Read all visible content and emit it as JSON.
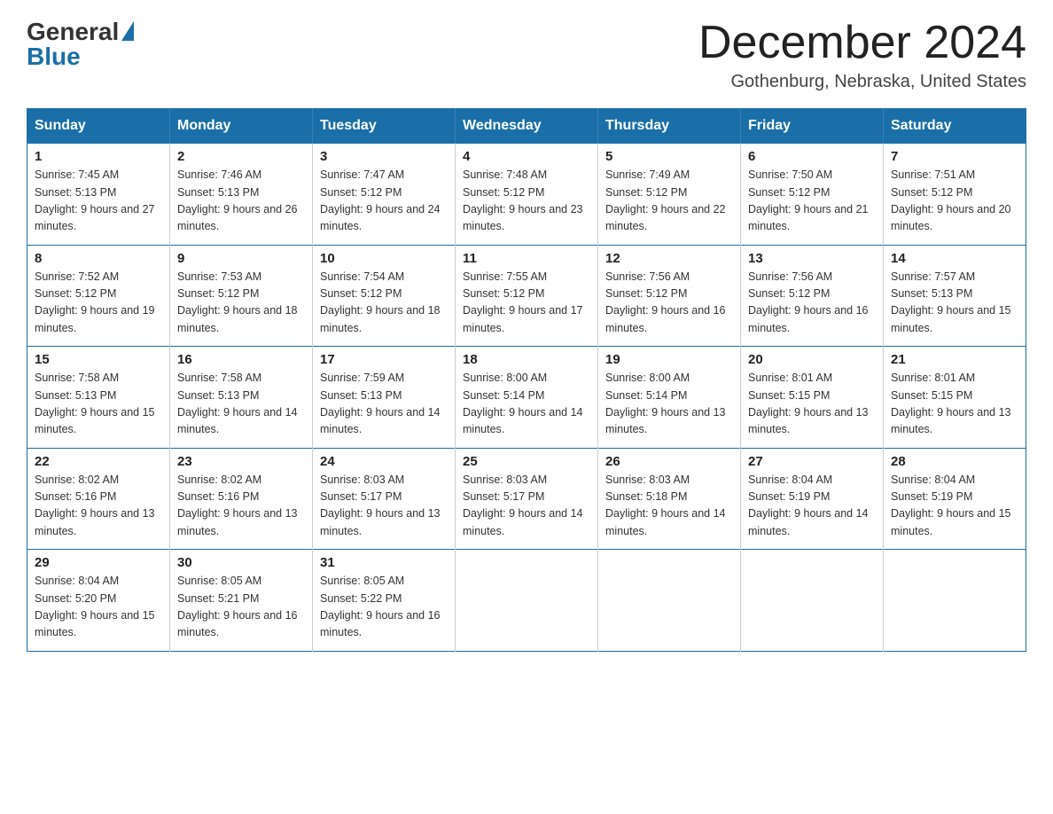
{
  "header": {
    "logo_general": "General",
    "logo_blue": "Blue",
    "month_title": "December 2024",
    "location": "Gothenburg, Nebraska, United States"
  },
  "days_of_week": [
    "Sunday",
    "Monday",
    "Tuesday",
    "Wednesday",
    "Thursday",
    "Friday",
    "Saturday"
  ],
  "weeks": [
    [
      {
        "day": "1",
        "sunrise": "7:45 AM",
        "sunset": "5:13 PM",
        "daylight": "9 hours and 27 minutes."
      },
      {
        "day": "2",
        "sunrise": "7:46 AM",
        "sunset": "5:13 PM",
        "daylight": "9 hours and 26 minutes."
      },
      {
        "day": "3",
        "sunrise": "7:47 AM",
        "sunset": "5:12 PM",
        "daylight": "9 hours and 24 minutes."
      },
      {
        "day": "4",
        "sunrise": "7:48 AM",
        "sunset": "5:12 PM",
        "daylight": "9 hours and 23 minutes."
      },
      {
        "day": "5",
        "sunrise": "7:49 AM",
        "sunset": "5:12 PM",
        "daylight": "9 hours and 22 minutes."
      },
      {
        "day": "6",
        "sunrise": "7:50 AM",
        "sunset": "5:12 PM",
        "daylight": "9 hours and 21 minutes."
      },
      {
        "day": "7",
        "sunrise": "7:51 AM",
        "sunset": "5:12 PM",
        "daylight": "9 hours and 20 minutes."
      }
    ],
    [
      {
        "day": "8",
        "sunrise": "7:52 AM",
        "sunset": "5:12 PM",
        "daylight": "9 hours and 19 minutes."
      },
      {
        "day": "9",
        "sunrise": "7:53 AM",
        "sunset": "5:12 PM",
        "daylight": "9 hours and 18 minutes."
      },
      {
        "day": "10",
        "sunrise": "7:54 AM",
        "sunset": "5:12 PM",
        "daylight": "9 hours and 18 minutes."
      },
      {
        "day": "11",
        "sunrise": "7:55 AM",
        "sunset": "5:12 PM",
        "daylight": "9 hours and 17 minutes."
      },
      {
        "day": "12",
        "sunrise": "7:56 AM",
        "sunset": "5:12 PM",
        "daylight": "9 hours and 16 minutes."
      },
      {
        "day": "13",
        "sunrise": "7:56 AM",
        "sunset": "5:12 PM",
        "daylight": "9 hours and 16 minutes."
      },
      {
        "day": "14",
        "sunrise": "7:57 AM",
        "sunset": "5:13 PM",
        "daylight": "9 hours and 15 minutes."
      }
    ],
    [
      {
        "day": "15",
        "sunrise": "7:58 AM",
        "sunset": "5:13 PM",
        "daylight": "9 hours and 15 minutes."
      },
      {
        "day": "16",
        "sunrise": "7:58 AM",
        "sunset": "5:13 PM",
        "daylight": "9 hours and 14 minutes."
      },
      {
        "day": "17",
        "sunrise": "7:59 AM",
        "sunset": "5:13 PM",
        "daylight": "9 hours and 14 minutes."
      },
      {
        "day": "18",
        "sunrise": "8:00 AM",
        "sunset": "5:14 PM",
        "daylight": "9 hours and 14 minutes."
      },
      {
        "day": "19",
        "sunrise": "8:00 AM",
        "sunset": "5:14 PM",
        "daylight": "9 hours and 13 minutes."
      },
      {
        "day": "20",
        "sunrise": "8:01 AM",
        "sunset": "5:15 PM",
        "daylight": "9 hours and 13 minutes."
      },
      {
        "day": "21",
        "sunrise": "8:01 AM",
        "sunset": "5:15 PM",
        "daylight": "9 hours and 13 minutes."
      }
    ],
    [
      {
        "day": "22",
        "sunrise": "8:02 AM",
        "sunset": "5:16 PM",
        "daylight": "9 hours and 13 minutes."
      },
      {
        "day": "23",
        "sunrise": "8:02 AM",
        "sunset": "5:16 PM",
        "daylight": "9 hours and 13 minutes."
      },
      {
        "day": "24",
        "sunrise": "8:03 AM",
        "sunset": "5:17 PM",
        "daylight": "9 hours and 13 minutes."
      },
      {
        "day": "25",
        "sunrise": "8:03 AM",
        "sunset": "5:17 PM",
        "daylight": "9 hours and 14 minutes."
      },
      {
        "day": "26",
        "sunrise": "8:03 AM",
        "sunset": "5:18 PM",
        "daylight": "9 hours and 14 minutes."
      },
      {
        "day": "27",
        "sunrise": "8:04 AM",
        "sunset": "5:19 PM",
        "daylight": "9 hours and 14 minutes."
      },
      {
        "day": "28",
        "sunrise": "8:04 AM",
        "sunset": "5:19 PM",
        "daylight": "9 hours and 15 minutes."
      }
    ],
    [
      {
        "day": "29",
        "sunrise": "8:04 AM",
        "sunset": "5:20 PM",
        "daylight": "9 hours and 15 minutes."
      },
      {
        "day": "30",
        "sunrise": "8:05 AM",
        "sunset": "5:21 PM",
        "daylight": "9 hours and 16 minutes."
      },
      {
        "day": "31",
        "sunrise": "8:05 AM",
        "sunset": "5:22 PM",
        "daylight": "9 hours and 16 minutes."
      },
      null,
      null,
      null,
      null
    ]
  ]
}
